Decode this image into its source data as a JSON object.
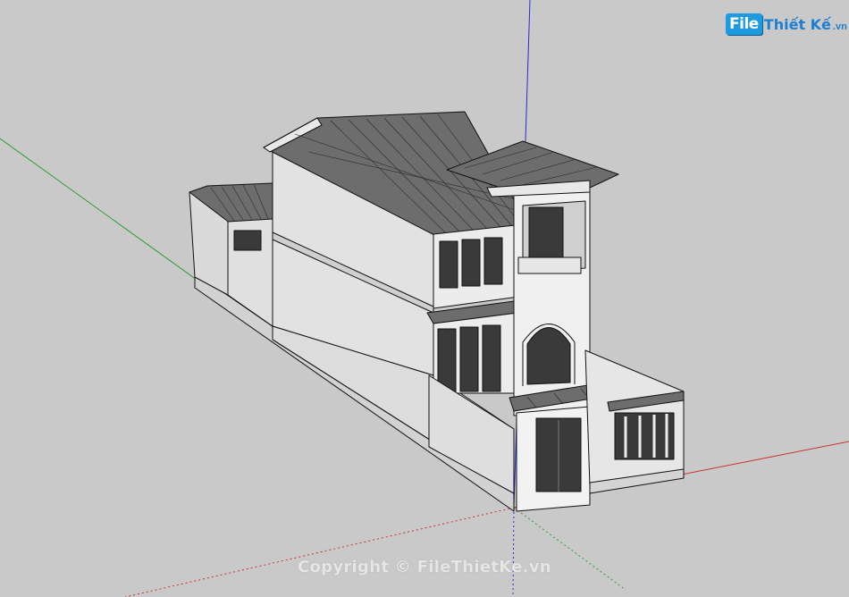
{
  "watermark": {
    "logo_mark": "File",
    "logo_text": "Thiết Kế",
    "logo_tld": ".vn",
    "copyright": "Copyright © FileThietKe.vn"
  },
  "scene": {
    "axis_colors": {
      "red": "#c83232",
      "green": "#2f9a2f",
      "blue": "#2a2ad0"
    },
    "model_colors": {
      "wall": "#e4e4e4",
      "wall_shade": "#cfcfcf",
      "roof": "#6d6d6d",
      "window": "#3a3a3a",
      "outline": "#111111"
    }
  }
}
